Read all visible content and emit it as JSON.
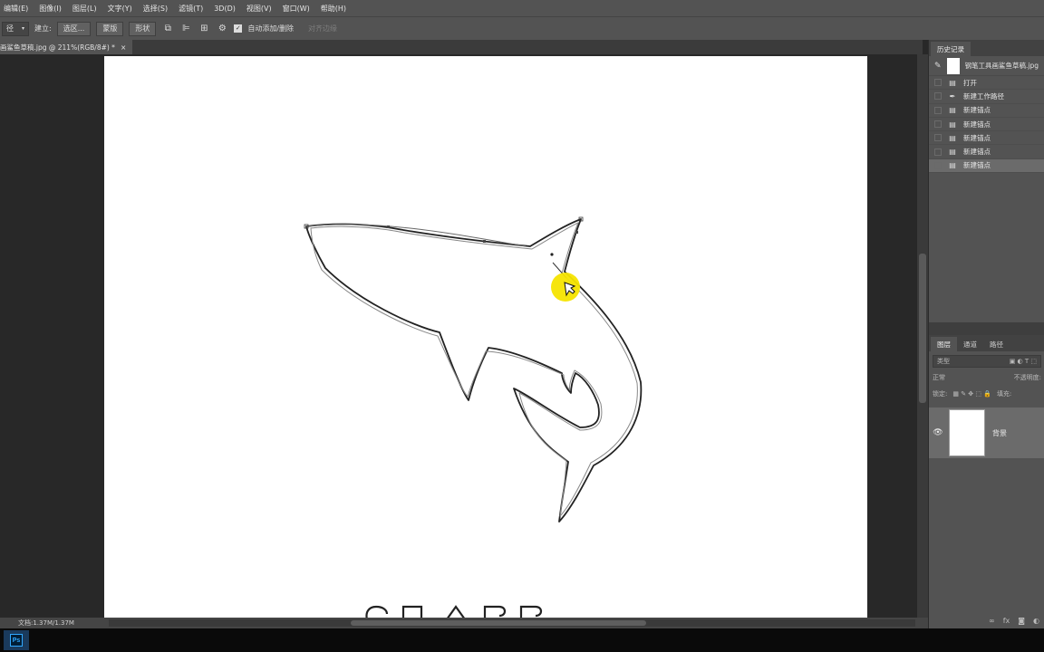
{
  "menu": [
    "编辑(E)",
    "图像(I)",
    "图层(L)",
    "文字(Y)",
    "选择(S)",
    "滤镜(T)",
    "3D(D)",
    "视图(V)",
    "窗口(W)",
    "帮助(H)"
  ],
  "options": {
    "mode_select": "径",
    "make_label": "建立:",
    "selection_btn": "选区...",
    "mask_btn": "蒙版",
    "shape_btn": "形状",
    "auto_add_delete": "自动添加/删除",
    "align_edges": "对齐边缘"
  },
  "document": {
    "tab_title": "画鲨鱼草稿.jpg @ 211%(RGB/8#) *",
    "close": "×"
  },
  "status": {
    "doc_size": "文档:1.37M/1.37M"
  },
  "history_panel": {
    "tab": "历史记录",
    "snapshot_label": "钢笔工具画鲨鱼草稿.jpg",
    "items": [
      {
        "label": "打开",
        "icon": "document-icon"
      },
      {
        "label": "新建工作路径",
        "icon": "pen-icon"
      },
      {
        "label": "新建锚点",
        "icon": "document-icon"
      },
      {
        "label": "新建锚点",
        "icon": "document-icon"
      },
      {
        "label": "新建锚点",
        "icon": "document-icon"
      },
      {
        "label": "新建锚点",
        "icon": "document-icon"
      },
      {
        "label": "新建锚点",
        "icon": "document-icon",
        "selected": true
      }
    ]
  },
  "layers_panel": {
    "tabs": [
      "图层",
      "通道",
      "路径"
    ],
    "filter_placeholder": "类型",
    "blend_mode": "正常",
    "opacity_label": "不透明度:",
    "lock_label": "锁定:",
    "fill_label": "填充:",
    "layer_name": "背景"
  },
  "taskbar": {
    "ps_label": "Ps"
  },
  "colors": {
    "ui_panel": "#535353",
    "workspace": "#282828",
    "cursor_highlight": "#f5e400"
  }
}
